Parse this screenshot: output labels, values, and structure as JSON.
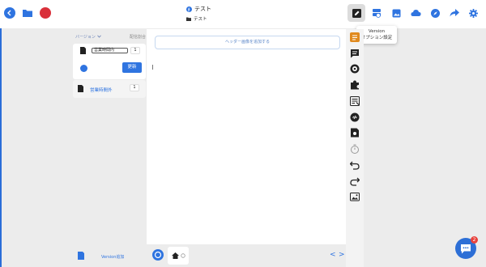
{
  "header": {
    "title": "テスト",
    "subtitle": "テスト"
  },
  "tooltip": {
    "line1": "Version",
    "line2": "オプション設定"
  },
  "left_panel": {
    "version_label": "バージョン",
    "sort_label": "配信割合",
    "rows": [
      {
        "name": "営業時間内",
        "order": "1",
        "update_label": "更新"
      },
      {
        "name": "営業時間外",
        "order": "1"
      }
    ],
    "add_version_label": "Version追加"
  },
  "canvas": {
    "header_add_label": "ヘッダー画像を追加する"
  },
  "chat": {
    "badge_count": "2"
  },
  "colors": {
    "accent": "#2f74e0",
    "logo": "#d9303a",
    "chat_fab": "#2d6fd6",
    "badge": "#e8423c",
    "orange_rail": "#e08a1e"
  }
}
